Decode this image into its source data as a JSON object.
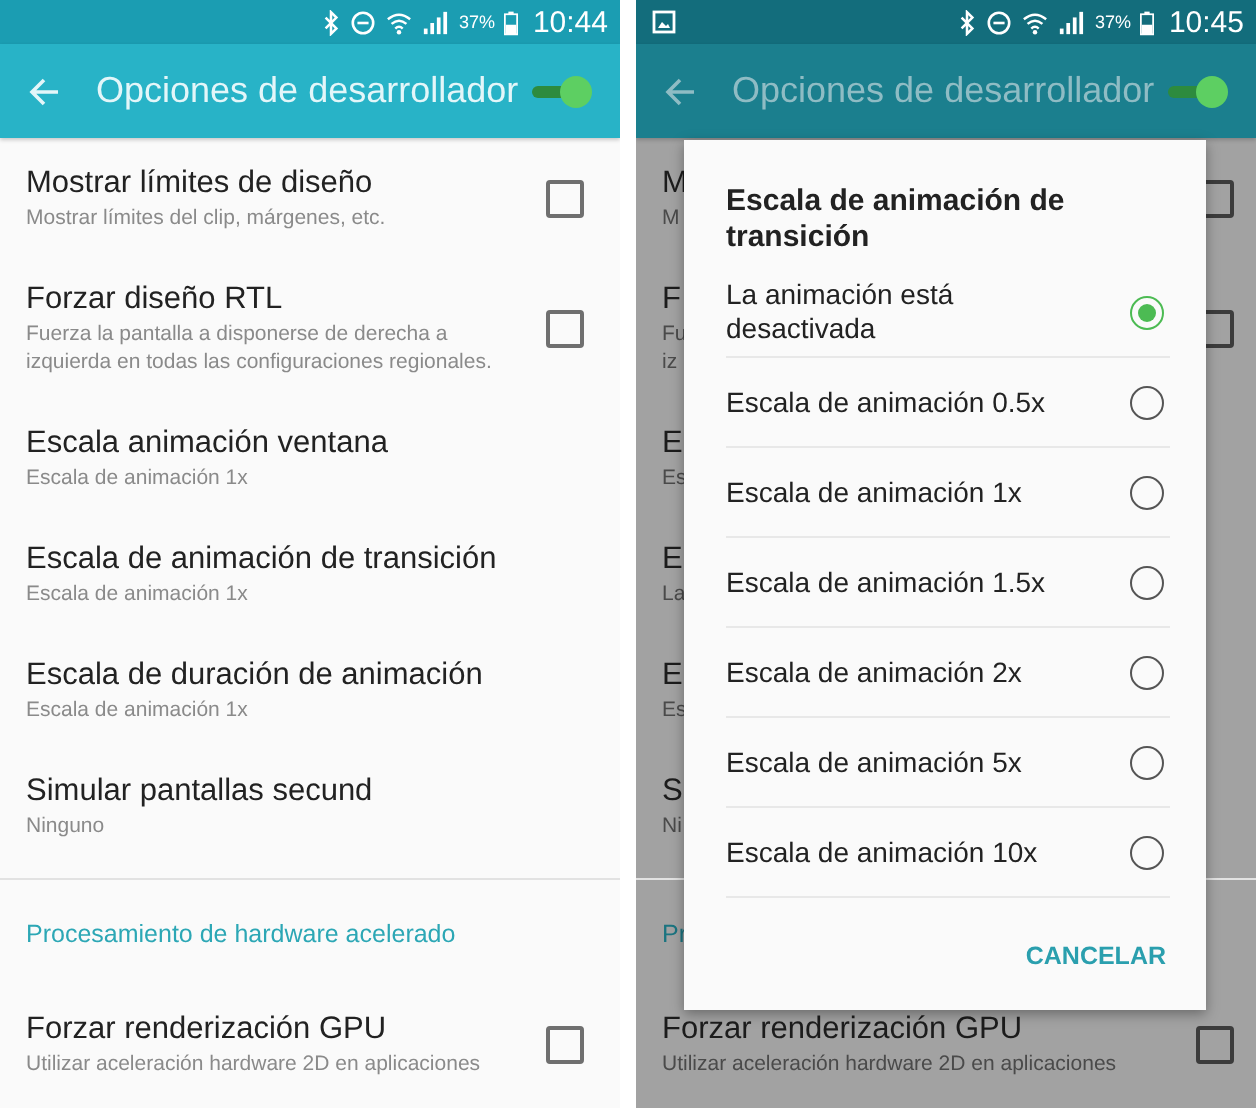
{
  "screens": [
    {
      "status_bar": {
        "battery": "37%",
        "time": "10:44"
      },
      "toolbar": {
        "title": "Opciones de desarrollador",
        "switch_on": true
      },
      "list": [
        {
          "kind": "setting",
          "title": "Mostrar límites de diseño",
          "subtitle": "Mostrar límites del clip, márgenes, etc.",
          "checked": false
        },
        {
          "kind": "setting",
          "title": "Forzar diseño RTL",
          "subtitle": "Fuerza la pantalla a disponerse de derecha a izquierda en todas las configuraciones regionales.",
          "checked": false
        },
        {
          "kind": "setting",
          "title": "Escala animación ventana",
          "subtitle": "Escala de animación 1x"
        },
        {
          "kind": "setting",
          "title": "Escala de animación de transición",
          "subtitle": "Escala de animación 1x"
        },
        {
          "kind": "setting",
          "title": "Escala de duración de animación",
          "subtitle": "Escala de animación 1x"
        },
        {
          "kind": "setting",
          "title": "Simular pantallas secund",
          "subtitle": "Ninguno"
        },
        {
          "kind": "divider"
        },
        {
          "kind": "header",
          "title": "Procesamiento de hardware acelerado"
        },
        {
          "kind": "setting",
          "title": "Forzar renderización GPU",
          "subtitle": "Utilizar aceleración hardware 2D en aplicaciones",
          "checked": false
        }
      ]
    },
    {
      "status_bar": {
        "notifications": [
          {
            "kind": "image"
          }
        ],
        "battery": "37%",
        "time": "10:45"
      },
      "toolbar": {
        "title": "Opciones de desarrollador",
        "switch_on": true
      },
      "list": [
        {
          "kind": "setting",
          "title": "M",
          "subtitle": "M",
          "checked": false
        },
        {
          "kind": "setting",
          "title": "F",
          "subtitle": "Fu\niz",
          "checked": false
        },
        {
          "kind": "setting",
          "title": "E",
          "subtitle": "Es"
        },
        {
          "kind": "setting",
          "title": "E",
          "subtitle": "La"
        },
        {
          "kind": "setting",
          "title": "E",
          "subtitle": "Es"
        },
        {
          "kind": "setting",
          "title": "S",
          "subtitle": "Ni"
        },
        {
          "kind": "divider"
        },
        {
          "kind": "header",
          "title": "Pr"
        },
        {
          "kind": "setting",
          "title": "Forzar renderización GPU",
          "subtitle": "Utilizar aceleración hardware 2D en aplicaciones",
          "checked": false
        }
      ],
      "dialog": {
        "title": "Escala de animación de transición",
        "options": [
          {
            "label": "La animación está desactivada",
            "selected": true
          },
          {
            "label": "Escala de animación 0.5x",
            "selected": false
          },
          {
            "label": "Escala de animación 1x",
            "selected": false
          },
          {
            "label": "Escala de animación 1.5x",
            "selected": false
          },
          {
            "label": "Escala de animación 2x",
            "selected": false
          },
          {
            "label": "Escala de animación 5x",
            "selected": false
          },
          {
            "label": "Escala de animación 10x",
            "selected": false
          }
        ],
        "button": "CANCELAR"
      }
    }
  ]
}
